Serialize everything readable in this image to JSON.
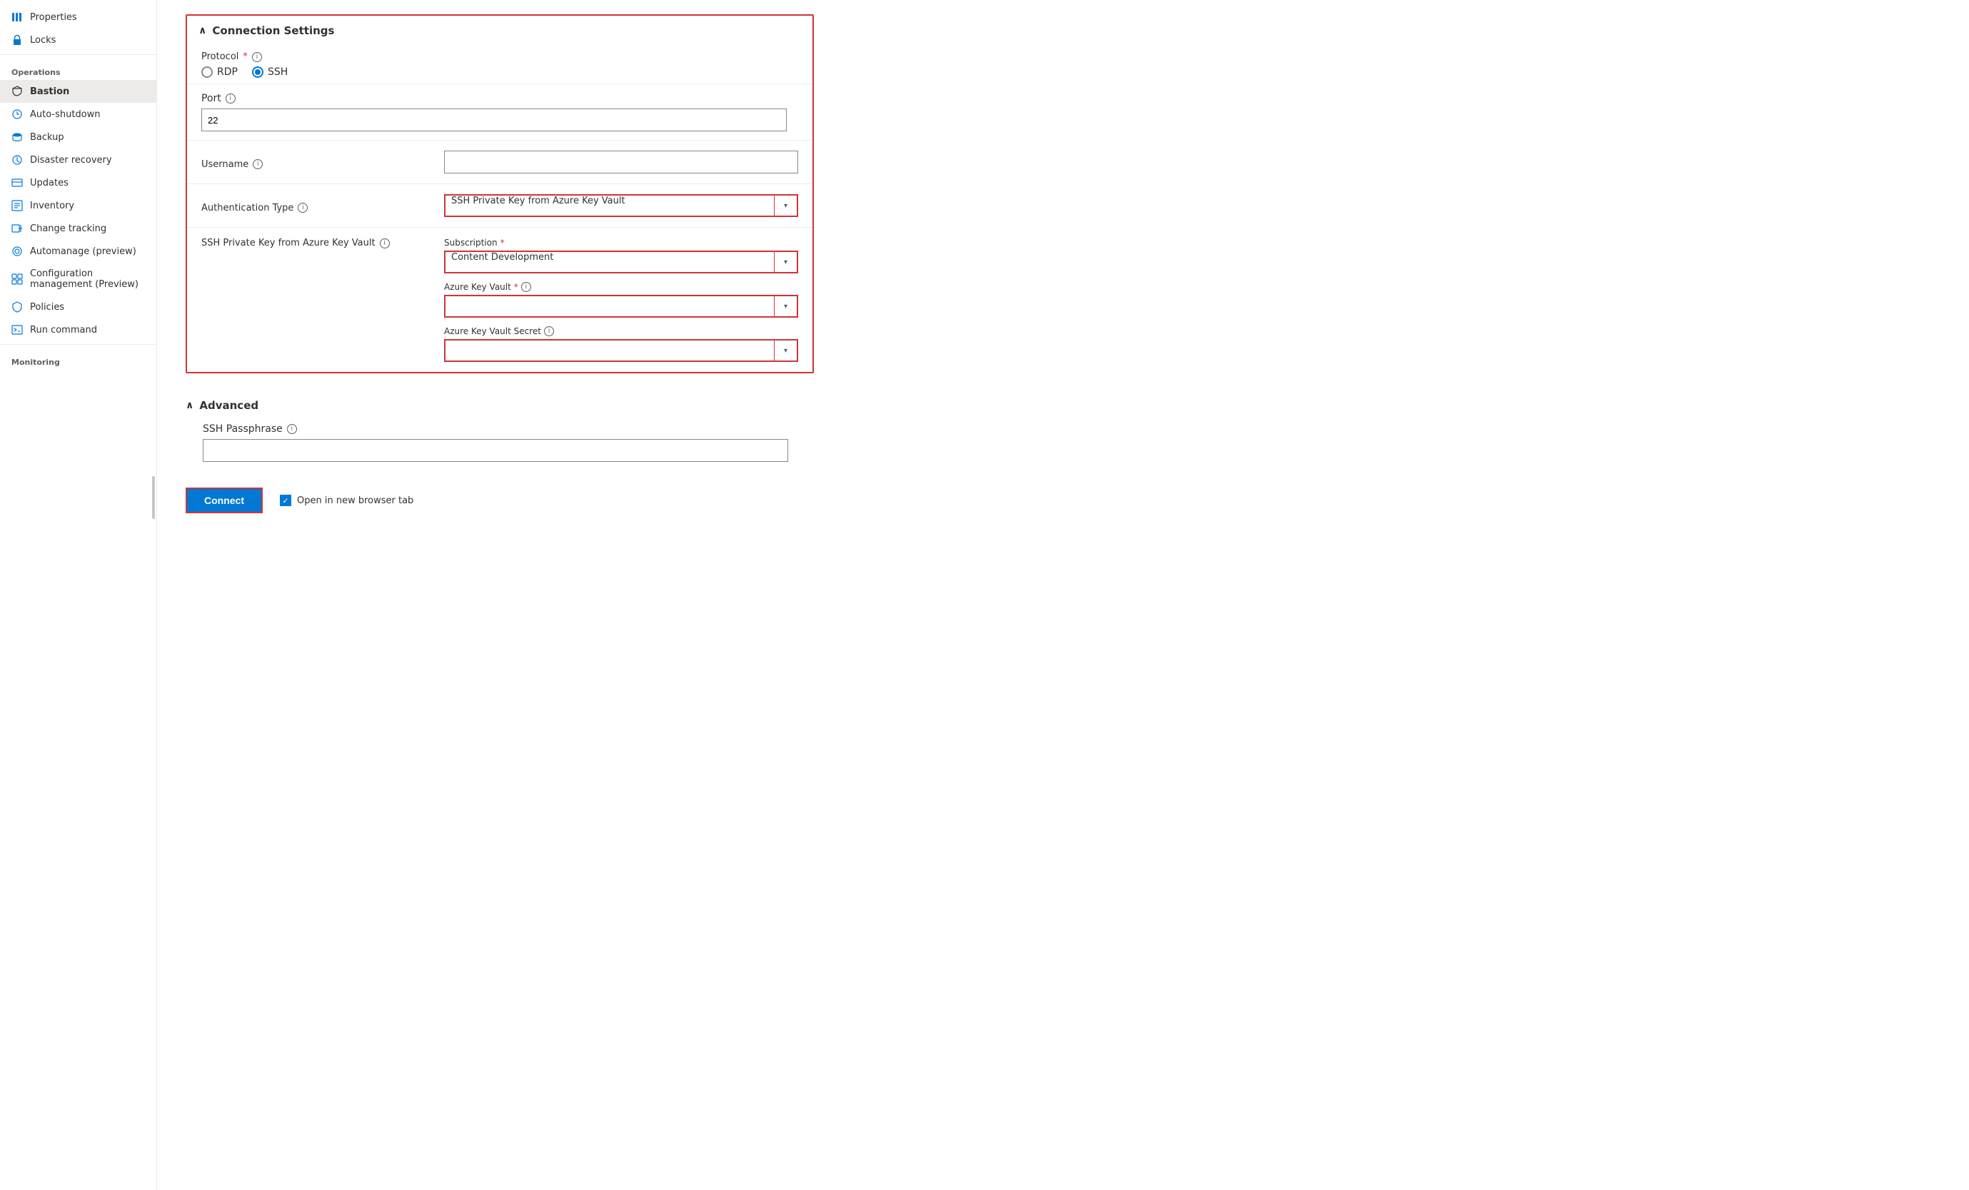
{
  "sidebar": {
    "items": [
      {
        "id": "properties",
        "label": "Properties",
        "icon": "properties-icon",
        "section": null,
        "active": false
      },
      {
        "id": "locks",
        "label": "Locks",
        "icon": "lock-icon",
        "section": null,
        "active": false
      },
      {
        "id": "operations-section",
        "label": "Operations",
        "type": "section"
      },
      {
        "id": "bastion",
        "label": "Bastion",
        "icon": "bastion-icon",
        "active": true
      },
      {
        "id": "auto-shutdown",
        "label": "Auto-shutdown",
        "icon": "autoshutdown-icon",
        "active": false
      },
      {
        "id": "backup",
        "label": "Backup",
        "icon": "backup-icon",
        "active": false
      },
      {
        "id": "disaster-recovery",
        "label": "Disaster recovery",
        "icon": "disaster-icon",
        "active": false
      },
      {
        "id": "updates",
        "label": "Updates",
        "icon": "updates-icon",
        "active": false
      },
      {
        "id": "inventory",
        "label": "Inventory",
        "icon": "inventory-icon",
        "active": false
      },
      {
        "id": "change-tracking",
        "label": "Change tracking",
        "icon": "changetracking-icon",
        "active": false
      },
      {
        "id": "automanage",
        "label": "Automanage (preview)",
        "icon": "automanage-icon",
        "active": false
      },
      {
        "id": "config-management",
        "label": "Configuration management (Preview)",
        "icon": "config-icon",
        "active": false
      },
      {
        "id": "policies",
        "label": "Policies",
        "icon": "policies-icon",
        "active": false
      },
      {
        "id": "run-command",
        "label": "Run command",
        "icon": "runcommand-icon",
        "active": false
      },
      {
        "id": "monitoring-section",
        "label": "Monitoring",
        "type": "section"
      }
    ]
  },
  "connection_settings": {
    "title": "Connection Settings",
    "collapsed": false,
    "protocol_label": "Protocol",
    "rdp_label": "RDP",
    "ssh_label": "SSH",
    "selected_protocol": "SSH",
    "port_label": "Port",
    "port_value": "22",
    "username_label": "Username",
    "username_value": "",
    "username_placeholder": "",
    "auth_type_label": "Authentication Type",
    "auth_type_value": "SSH Private Key from Azure Key Vault",
    "ssh_key_label": "SSH Private Key from Azure Key Vault",
    "subscription_label": "Subscription",
    "subscription_required": true,
    "subscription_value": "Content Development",
    "azure_key_vault_label": "Azure Key Vault",
    "azure_key_vault_required": true,
    "azure_key_vault_value": "",
    "azure_key_vault_secret_label": "Azure Key Vault Secret",
    "azure_key_vault_secret_value": ""
  },
  "advanced": {
    "title": "Advanced",
    "ssh_passphrase_label": "SSH Passphrase",
    "ssh_passphrase_value": ""
  },
  "footer": {
    "connect_label": "Connect",
    "open_new_tab_label": "Open in new browser tab",
    "open_new_tab_checked": true
  },
  "icons": {
    "chevron_down": "▾",
    "chevron_up": "∧",
    "info": "i",
    "check": "✓",
    "x_mark": "✕"
  }
}
